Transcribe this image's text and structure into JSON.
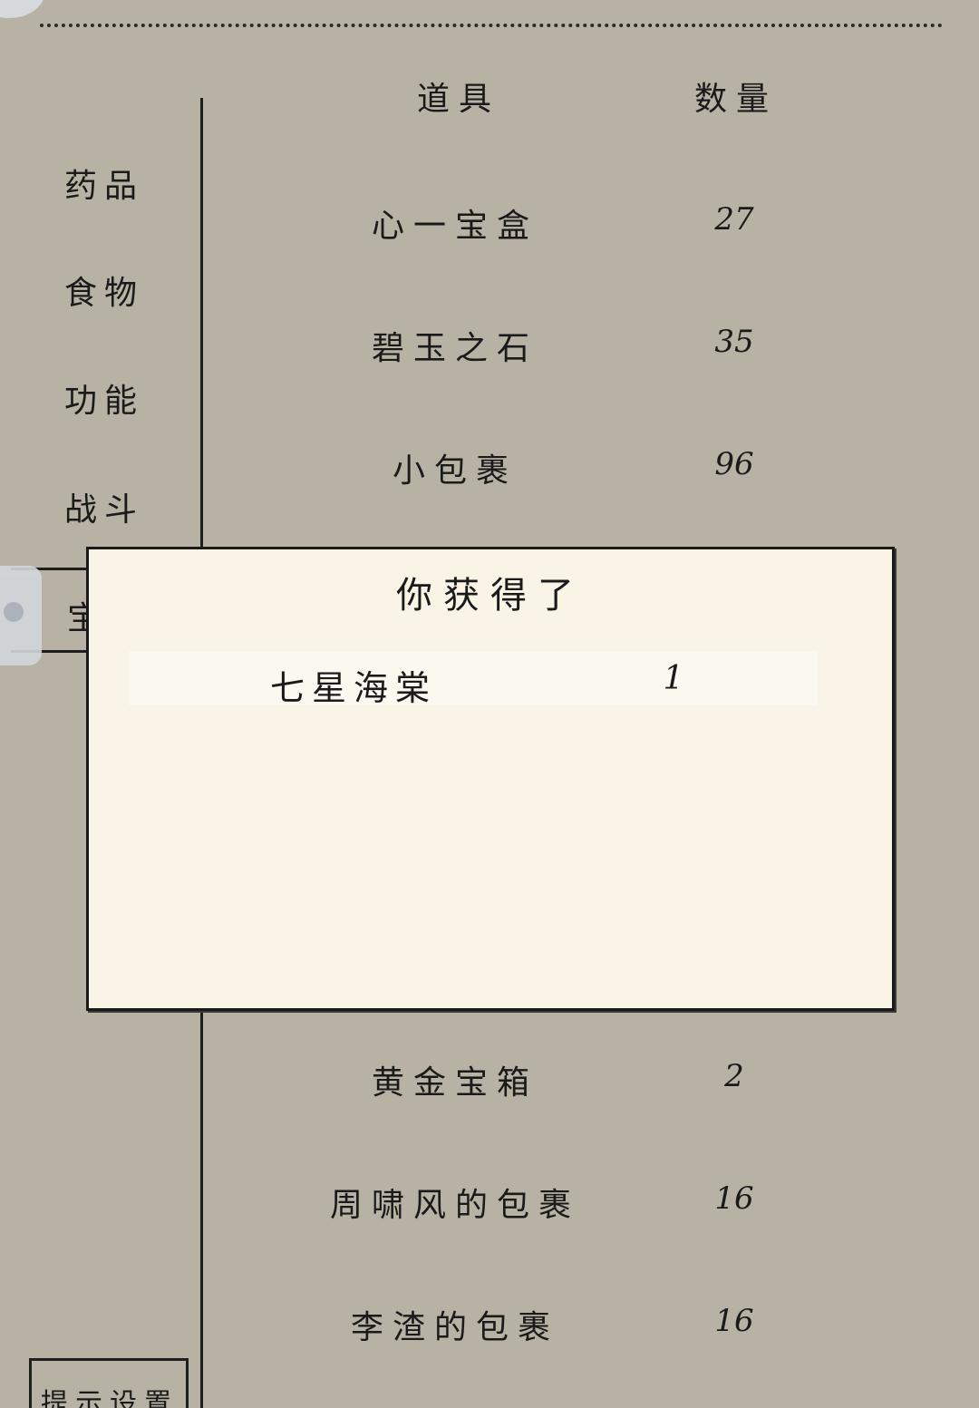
{
  "sidebar": {
    "items": [
      {
        "label": "药品"
      },
      {
        "label": "食物"
      },
      {
        "label": "功能"
      },
      {
        "label": "战斗"
      }
    ],
    "selected_partial": "宝"
  },
  "table": {
    "headers": {
      "item": "道具",
      "qty": "数量"
    },
    "rows_top": [
      {
        "name": "心一宝盒",
        "qty": "27"
      },
      {
        "name": "碧玉之石",
        "qty": "35"
      },
      {
        "name": "小包裹",
        "qty": "96"
      }
    ],
    "rows_bottom": [
      {
        "name": "黄金宝箱",
        "qty": "2"
      },
      {
        "name": "周啸风的包裹",
        "qty": "16"
      },
      {
        "name": "李渣的包裹",
        "qty": "16"
      }
    ]
  },
  "hint_button": {
    "label": "提示设置"
  },
  "popup": {
    "title": "你获得了",
    "item": {
      "name": "七星海棠",
      "qty": "1"
    }
  }
}
